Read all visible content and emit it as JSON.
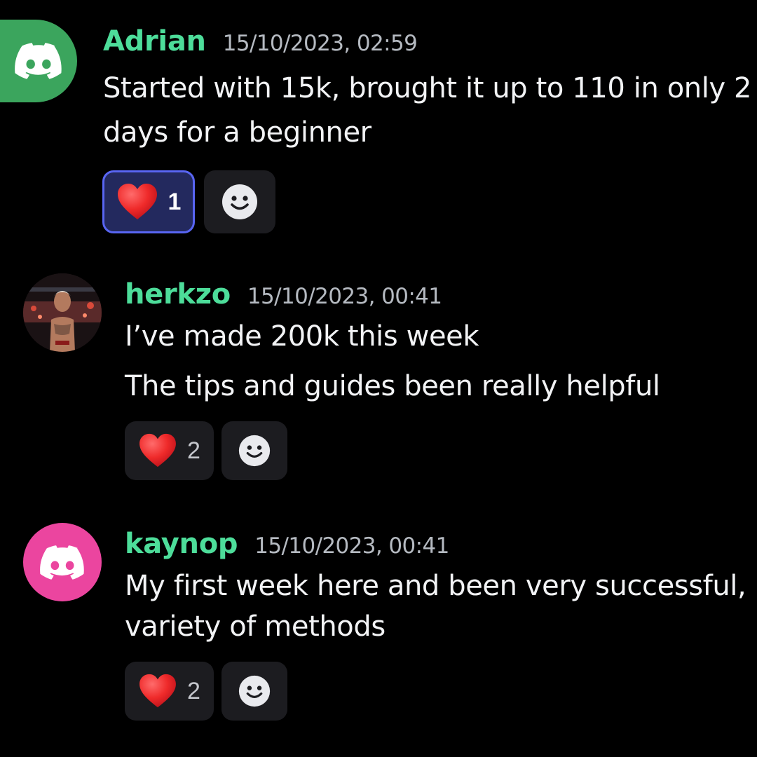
{
  "messages": [
    {
      "username": "Adrian",
      "timestamp": "15/10/2023, 02:59",
      "lines": [
        "Started with 15k, brought it up to 110 in only 2",
        "days for a beginner"
      ],
      "avatar": {
        "type": "discord-logo",
        "color": "#3ba55d"
      },
      "reaction": {
        "emoji": "heart-emoji",
        "count": "1",
        "active": true
      }
    },
    {
      "username": "herkzo",
      "timestamp": "15/10/2023, 00:41",
      "lines": [
        "I’ve made 200k this week",
        "The tips and guides been really helpful"
      ],
      "avatar": {
        "type": "profile-photo"
      },
      "reaction": {
        "emoji": "heart-emoji",
        "count": "2",
        "active": false
      }
    },
    {
      "username": "kaynop",
      "timestamp": "15/10/2023, 00:41",
      "lines": [
        "My first week here and been very successful,",
        "variety of methods"
      ],
      "avatar": {
        "type": "discord-logo",
        "color": "#eb459f"
      },
      "reaction": {
        "emoji": "heart-emoji",
        "count": "2",
        "active": false
      }
    }
  ],
  "colors": {
    "background": "#000000",
    "username": "#4ddd9a",
    "timestamp": "#b5bac1",
    "text": "#f2f3f5",
    "reaction_bg": "#1c1c20",
    "reaction_active_bg": "#23295e",
    "reaction_active_border": "#5865f2",
    "heart": "#e8202a"
  },
  "icons": {
    "add_reaction": "smiley-add-reaction-icon",
    "discord": "discord-logo-icon"
  }
}
